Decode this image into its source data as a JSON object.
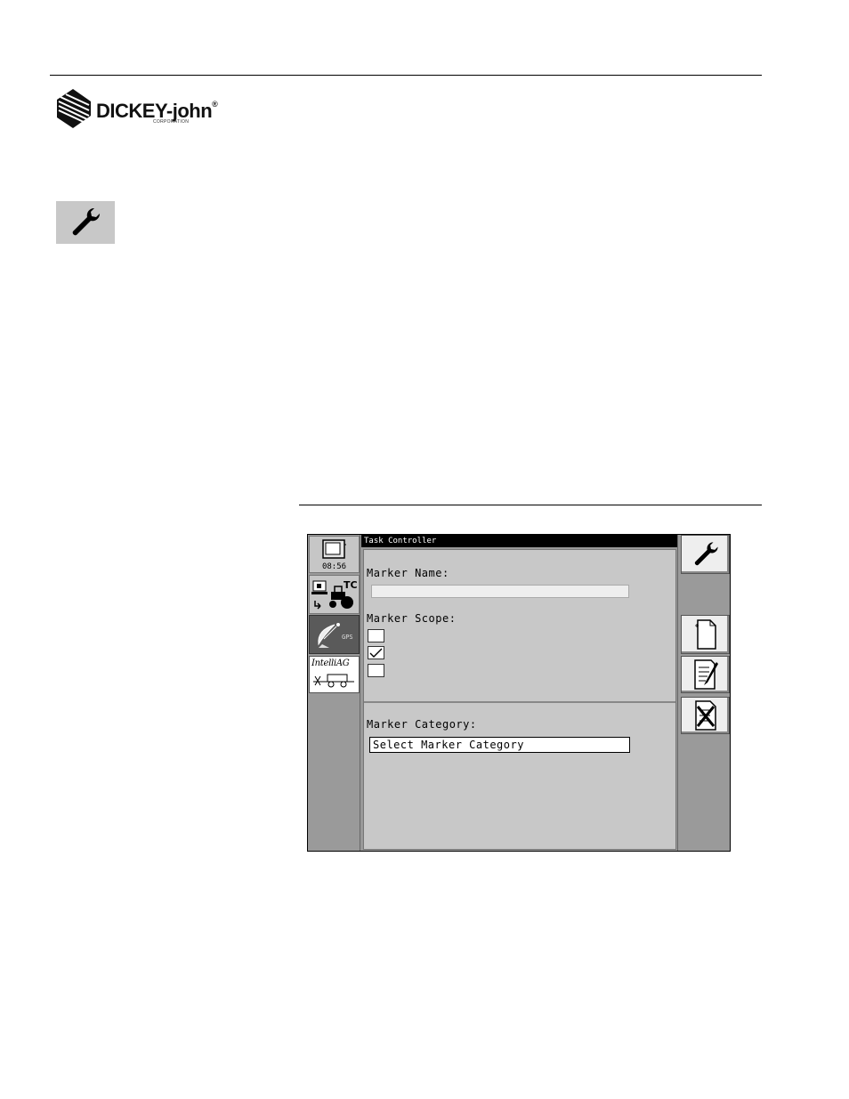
{
  "header": {
    "brand": "DICKEY-john",
    "brand_mark": "®",
    "brand_subtitle": "CORPORATION",
    "section_icon": "wrench-icon"
  },
  "screen": {
    "title": "Task Controller",
    "left_panel": {
      "clock": "08:56",
      "gps_label": "GPS",
      "intelliag_label": "IntelliAG"
    },
    "form": {
      "marker_name_label": "Marker Name:",
      "marker_name_value": "",
      "marker_scope_label": "Marker Scope:",
      "scope_options": [
        {
          "checked": false
        },
        {
          "checked": true
        },
        {
          "checked": false
        }
      ],
      "marker_category_label": "Marker Category:",
      "marker_category_value": "Select Marker Category"
    },
    "right_panel": {
      "buttons": [
        "wrench-icon",
        "new-document-icon",
        "edit-document-icon",
        "delete-document-icon"
      ]
    }
  }
}
